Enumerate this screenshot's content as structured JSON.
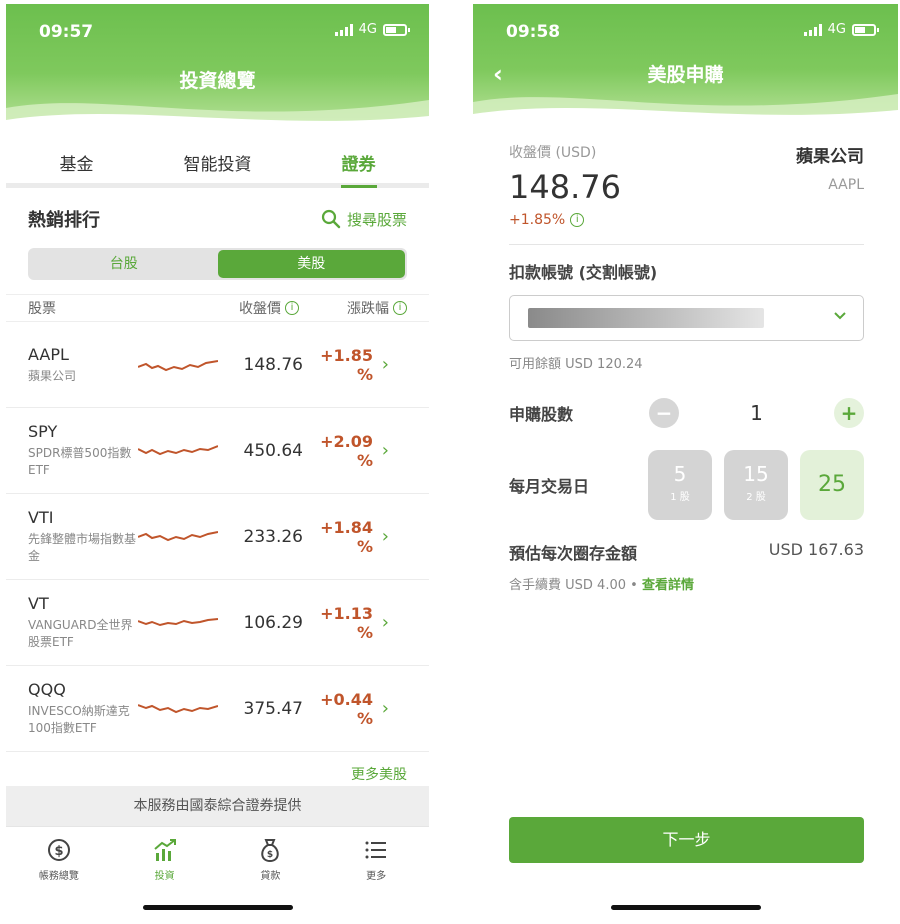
{
  "left": {
    "status": {
      "time": "09:57",
      "network": "4G"
    },
    "header_title": "投資總覽",
    "tabs": [
      {
        "label": "基金"
      },
      {
        "label": "智能投資"
      },
      {
        "label": "證券"
      }
    ],
    "section_title": "熱銷排行",
    "search_label": "搜尋股票",
    "segments": [
      {
        "label": "台股"
      },
      {
        "label": "美股"
      }
    ],
    "columns": {
      "stock": "股票",
      "close": "收盤價",
      "change": "漲跌幅"
    },
    "stocks": [
      {
        "code": "AAPL",
        "name": "蘋果公司",
        "price": "148.76",
        "change": "+1.85 %"
      },
      {
        "code": "SPY",
        "name": "SPDR標普500指數ETF",
        "price": "450.64",
        "change": "+2.09 %"
      },
      {
        "code": "VTI",
        "name": "先鋒整體市場指數基金",
        "price": "233.26",
        "change": "+1.84 %"
      },
      {
        "code": "VT",
        "name": "VANGUARD全世界股票ETF",
        "price": "106.29",
        "change": "+1.13 %"
      },
      {
        "code": "QQQ",
        "name": "INVESCO納斯達克100指數ETF",
        "price": "375.47",
        "change": "+0.44 %"
      }
    ],
    "more_label": "更多美股",
    "provider": "本服務由國泰綜合證券提供",
    "nav": [
      {
        "label": "帳務總覽",
        "icon": "dollar-circle-icon"
      },
      {
        "label": "投資",
        "icon": "growth-chart-icon"
      },
      {
        "label": "貸款",
        "icon": "money-bag-icon"
      },
      {
        "label": "更多",
        "icon": "menu-list-icon"
      }
    ],
    "accent_color": "#5aa83a",
    "up_color": "#c0552b"
  },
  "right": {
    "status": {
      "time": "09:58",
      "network": "4G"
    },
    "header_title": "美股申購",
    "close_price_label": "收盤價 (USD)",
    "price": "148.76",
    "change": "+1.85%",
    "company": "蘋果公司",
    "symbol": "AAPL",
    "account_label": "扣款帳號 (交割帳號)",
    "available": "可用餘額 USD 120.24",
    "qty_label": "申購股數",
    "qty_value": "1",
    "day_label": "每月交易日",
    "days": [
      {
        "num": "5",
        "sub": "1 股"
      },
      {
        "num": "15",
        "sub": "2 股"
      },
      {
        "num": "25",
        "sub": ""
      }
    ],
    "est_label": "預估每次圈存金額",
    "est_value": "USD 167.63",
    "fee_text": "含手續費 USD 4.00 •",
    "fee_link": "查看詳情",
    "next_label": "下一步"
  }
}
